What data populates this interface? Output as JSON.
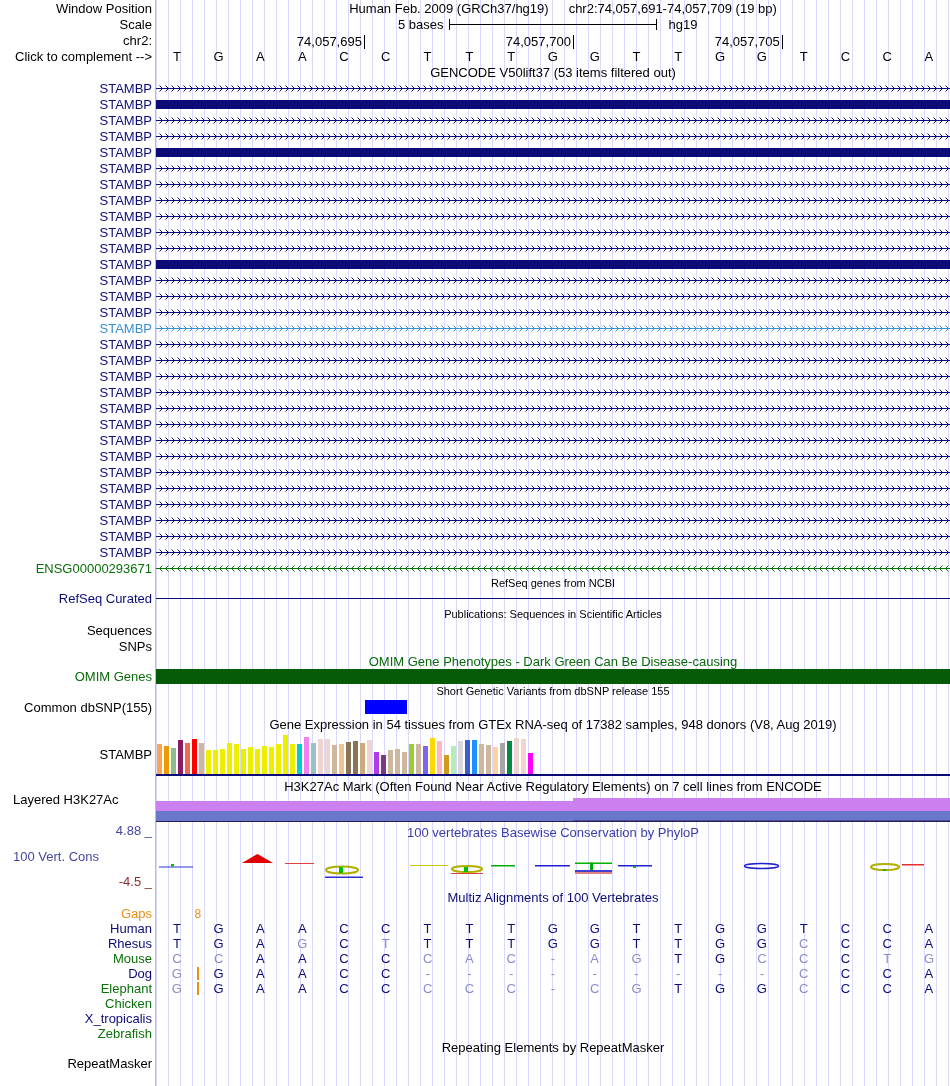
{
  "window_position": {
    "label": "Window Position",
    "assembly": "Human Feb. 2009 (GRCh37/hg19)",
    "range": "chr2:74,057,691-74,057,709 (19 bp)"
  },
  "scale": {
    "label": "Scale",
    "length": "5 bases",
    "assembly": "hg19"
  },
  "ruler": {
    "label": "chr2:",
    "ticks": [
      "74,057,695",
      "74,057,700",
      "74,057,705"
    ]
  },
  "sequence": {
    "label": "Click to complement -->",
    "bases": [
      "T",
      "G",
      "A",
      "A",
      "C",
      "C",
      "T",
      "T",
      "T",
      "G",
      "G",
      "T",
      "T",
      "G",
      "G",
      "T",
      "C",
      "C",
      "A"
    ]
  },
  "gencode": {
    "title": "GENCODE V50lift37 (53 items filtered out)",
    "items": [
      {
        "name": "STAMBP",
        "kind": "forward",
        "color": "#0c0c78"
      },
      {
        "name": "STAMBP",
        "kind": "exon",
        "color": "#0c0c78"
      },
      {
        "name": "STAMBP",
        "kind": "forward",
        "color": "#0c0c78"
      },
      {
        "name": "STAMBP",
        "kind": "forward",
        "color": "#0c0c78"
      },
      {
        "name": "STAMBP",
        "kind": "exon",
        "color": "#0c0c78"
      },
      {
        "name": "STAMBP",
        "kind": "forward",
        "color": "#0c0c78"
      },
      {
        "name": "STAMBP",
        "kind": "forward",
        "color": "#0c0c78"
      },
      {
        "name": "STAMBP",
        "kind": "forward",
        "color": "#0c0c78"
      },
      {
        "name": "STAMBP",
        "kind": "forward",
        "color": "#0c0c78"
      },
      {
        "name": "STAMBP",
        "kind": "forward",
        "color": "#0c0c78"
      },
      {
        "name": "STAMBP",
        "kind": "forward",
        "color": "#0c0c78"
      },
      {
        "name": "STAMBP",
        "kind": "exon",
        "color": "#0c0c78"
      },
      {
        "name": "STAMBP",
        "kind": "forward",
        "color": "#0c0c78"
      },
      {
        "name": "STAMBP",
        "kind": "forward",
        "color": "#0c0c78"
      },
      {
        "name": "STAMBP",
        "kind": "forward",
        "color": "#0c0c78"
      },
      {
        "name": "STAMBP",
        "kind": "forward",
        "color": "#3a8fcf"
      },
      {
        "name": "STAMBP",
        "kind": "forward",
        "color": "#0c0c78"
      },
      {
        "name": "STAMBP",
        "kind": "forward",
        "color": "#0c0c78"
      },
      {
        "name": "STAMBP",
        "kind": "forward",
        "color": "#0c0c78"
      },
      {
        "name": "STAMBP",
        "kind": "forward",
        "color": "#0c0c78"
      },
      {
        "name": "STAMBP",
        "kind": "forward",
        "color": "#0c0c78"
      },
      {
        "name": "STAMBP",
        "kind": "forward",
        "color": "#0c0c78"
      },
      {
        "name": "STAMBP",
        "kind": "forward",
        "color": "#0c0c78"
      },
      {
        "name": "STAMBP",
        "kind": "forward",
        "color": "#0c0c78"
      },
      {
        "name": "STAMBP",
        "kind": "forward",
        "color": "#0c0c78"
      },
      {
        "name": "STAMBP",
        "kind": "forward",
        "color": "#0c0c78"
      },
      {
        "name": "STAMBP",
        "kind": "forward",
        "color": "#0c0c78"
      },
      {
        "name": "STAMBP",
        "kind": "forward",
        "color": "#0c0c78"
      },
      {
        "name": "STAMBP",
        "kind": "forward",
        "color": "#0c0c78"
      },
      {
        "name": "STAMBP",
        "kind": "forward",
        "color": "#0c0c78"
      },
      {
        "name": "ENSG00000293671",
        "kind": "reverse",
        "color": "#0a700a"
      }
    ]
  },
  "refseq": {
    "title": "RefSeq genes from NCBI",
    "label": "RefSeq Curated"
  },
  "publications": {
    "title": "Publications: Sequences in Scientific Articles",
    "labels": [
      "Sequences",
      "SNPs"
    ]
  },
  "omim": {
    "title": "OMIM Gene Phenotypes - Dark Green Can Be Disease-causing",
    "label": "OMIM Genes"
  },
  "dbsnp": {
    "title": "Short Genetic Variants from dbSNP release 155",
    "label": "Common dbSNP(155)"
  },
  "gtex": {
    "title": "Gene Expression in 54 tissues from GTEx RNA-seq of 17382 samples, 948 donors (V8, Aug 2019)",
    "label": "STAMBP"
  },
  "h3k27ac": {
    "title": "H3K27Ac Mark (Often Found Near Active Regulatory Elements) on 7 cell lines from ENCODE",
    "label": "Layered H3K27Ac"
  },
  "conservation": {
    "title": "100 vertebrates Basewise Conservation by PhyloP",
    "label": "100 Vert. Cons",
    "max_label": "4.88 _",
    "min_label": "-4.5 _"
  },
  "multiz": {
    "title": "Multiz Alignments of 100 Vertebrates",
    "gaps": {
      "label": "Gaps",
      "count": "8"
    },
    "species": [
      {
        "name": "Human",
        "color": "#0c0c78",
        "insertion": false,
        "bases": [
          {
            "text": "T",
            "differs": false
          },
          {
            "text": "G",
            "differs": false
          },
          {
            "text": "A",
            "differs": false
          },
          {
            "text": "A",
            "differs": false
          },
          {
            "text": "C",
            "differs": false
          },
          {
            "text": "C",
            "differs": false
          },
          {
            "text": "T",
            "differs": false
          },
          {
            "text": "T",
            "differs": false
          },
          {
            "text": "T",
            "differs": false
          },
          {
            "text": "G",
            "differs": false
          },
          {
            "text": "G",
            "differs": false
          },
          {
            "text": "T",
            "differs": false
          },
          {
            "text": "T",
            "differs": false
          },
          {
            "text": "G",
            "differs": false
          },
          {
            "text": "G",
            "differs": false
          },
          {
            "text": "T",
            "differs": false
          },
          {
            "text": "C",
            "differs": false
          },
          {
            "text": "C",
            "differs": false
          },
          {
            "text": "A",
            "differs": false
          }
        ]
      },
      {
        "name": "Rhesus",
        "color": "#0c0c78",
        "insertion": false,
        "bases": [
          {
            "text": "T",
            "differs": false
          },
          {
            "text": "G",
            "differs": false
          },
          {
            "text": "A",
            "differs": false
          },
          {
            "text": "G",
            "differs": true
          },
          {
            "text": "C",
            "differs": false
          },
          {
            "text": "T",
            "differs": true
          },
          {
            "text": "T",
            "differs": false
          },
          {
            "text": "T",
            "differs": false
          },
          {
            "text": "T",
            "differs": false
          },
          {
            "text": "G",
            "differs": false
          },
          {
            "text": "G",
            "differs": false
          },
          {
            "text": "T",
            "differs": false
          },
          {
            "text": "T",
            "differs": false
          },
          {
            "text": "G",
            "differs": false
          },
          {
            "text": "G",
            "differs": false
          },
          {
            "text": "C",
            "differs": true
          },
          {
            "text": "C",
            "differs": false
          },
          {
            "text": "C",
            "differs": false
          },
          {
            "text": "A",
            "differs": false
          }
        ]
      },
      {
        "name": "Mouse",
        "color": "#0a700a",
        "insertion": false,
        "bases": [
          {
            "text": "C",
            "differs": true
          },
          {
            "text": "C",
            "differs": true
          },
          {
            "text": "A",
            "differs": false
          },
          {
            "text": "A",
            "differs": false
          },
          {
            "text": "C",
            "differs": false
          },
          {
            "text": "C",
            "differs": false
          },
          {
            "text": "C",
            "differs": true
          },
          {
            "text": "A",
            "differs": true
          },
          {
            "text": "C",
            "differs": true
          },
          {
            "text": "-",
            "differs": true
          },
          {
            "text": "A",
            "differs": true
          },
          {
            "text": "G",
            "differs": true
          },
          {
            "text": "T",
            "differs": false
          },
          {
            "text": "G",
            "differs": false
          },
          {
            "text": "C",
            "differs": true
          },
          {
            "text": "C",
            "differs": true
          },
          {
            "text": "C",
            "differs": false
          },
          {
            "text": "T",
            "differs": true
          },
          {
            "text": "G",
            "differs": true
          }
        ]
      },
      {
        "name": "Dog",
        "color": "#0c0c78",
        "insertion": true,
        "bases": [
          {
            "text": "G",
            "differs": true
          },
          {
            "text": "G",
            "differs": false
          },
          {
            "text": "A",
            "differs": false
          },
          {
            "text": "A",
            "differs": false
          },
          {
            "text": "C",
            "differs": false
          },
          {
            "text": "C",
            "differs": false
          },
          {
            "text": "-",
            "differs": true
          },
          {
            "text": "-",
            "differs": true
          },
          {
            "text": "-",
            "differs": true
          },
          {
            "text": "-",
            "differs": true
          },
          {
            "text": "-",
            "differs": true
          },
          {
            "text": "-",
            "differs": true
          },
          {
            "text": "-",
            "differs": true
          },
          {
            "text": "-",
            "differs": true
          },
          {
            "text": "-",
            "differs": true
          },
          {
            "text": "C",
            "differs": true
          },
          {
            "text": "C",
            "differs": false
          },
          {
            "text": "C",
            "differs": false
          },
          {
            "text": "A",
            "differs": false
          }
        ]
      },
      {
        "name": "Elephant",
        "color": "#0a700a",
        "insertion": true,
        "bases": [
          {
            "text": "G",
            "differs": true
          },
          {
            "text": "G",
            "differs": false
          },
          {
            "text": "A",
            "differs": false
          },
          {
            "text": "A",
            "differs": false
          },
          {
            "text": "C",
            "differs": false
          },
          {
            "text": "C",
            "differs": false
          },
          {
            "text": "C",
            "differs": true
          },
          {
            "text": "C",
            "differs": true
          },
          {
            "text": "C",
            "differs": true
          },
          {
            "text": "-",
            "differs": true
          },
          {
            "text": "C",
            "differs": true
          },
          {
            "text": "G",
            "differs": true
          },
          {
            "text": "T",
            "differs": false
          },
          {
            "text": "G",
            "differs": false
          },
          {
            "text": "G",
            "differs": false
          },
          {
            "text": "C",
            "differs": true
          },
          {
            "text": "C",
            "differs": false
          },
          {
            "text": "C",
            "differs": false
          },
          {
            "text": "A",
            "differs": false
          }
        ]
      },
      {
        "name": "Chicken",
        "color": "#0a700a",
        "insertion": false
      },
      {
        "name": "X_tropicalis",
        "color": "#0c0c78",
        "insertion": false
      },
      {
        "name": "Zebrafish",
        "color": "#0a700a",
        "insertion": false
      }
    ]
  },
  "repeatmasker": {
    "title": "Repeating Elements by RepeatMasker",
    "label": "RepeatMasker"
  }
}
